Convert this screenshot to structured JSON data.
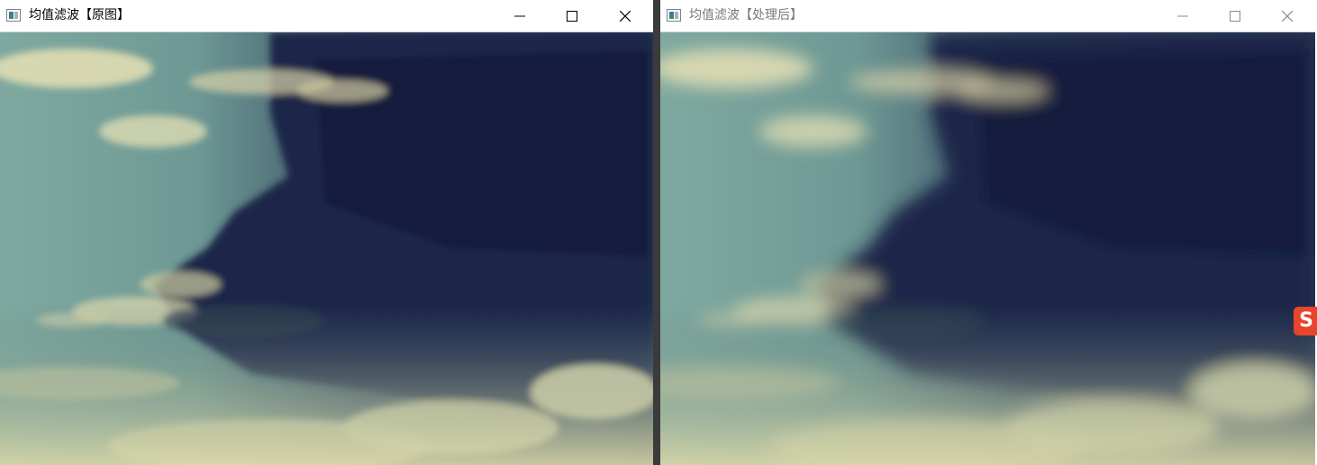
{
  "windows": [
    {
      "title": "均值滤波【原图】",
      "state": "active",
      "image": "sky-with-dark-clouds"
    },
    {
      "title": "均值滤波【处理后】",
      "state": "inactive",
      "image": "sky-with-dark-clouds-blurred"
    }
  ],
  "controls": {
    "minimize": "minimize-icon",
    "maximize": "maximize-icon",
    "close": "close-icon"
  },
  "taskbar_overlay": {
    "label": "S",
    "color": "#e8452b"
  },
  "colors": {
    "sky_light": "#7fa9a0",
    "cloud_dark": "#1b2748",
    "cloud_cream": "#e6e0b4"
  }
}
